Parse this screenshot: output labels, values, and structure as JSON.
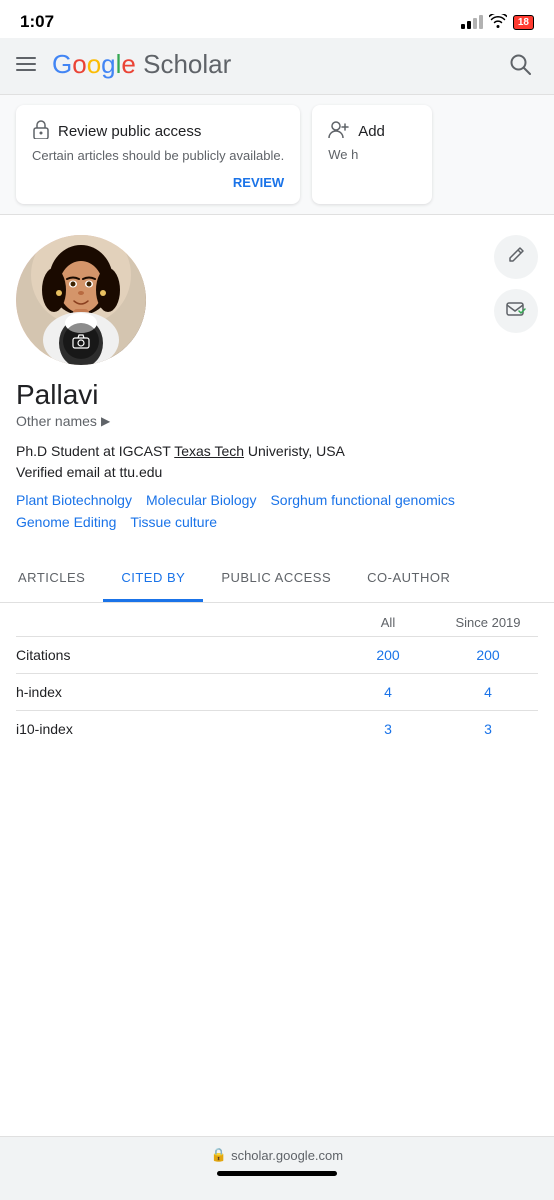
{
  "statusBar": {
    "time": "1:07",
    "battery": "18"
  },
  "header": {
    "logoLetters": [
      "G",
      "o",
      "o",
      "g",
      "l",
      "e"
    ],
    "logoScholar": " Scholar",
    "menuLabel": "menu",
    "searchLabel": "search"
  },
  "banners": [
    {
      "icon": "🔒",
      "title": "Review public access",
      "subtitle": "Certain articles should be publicly available.",
      "action": "REVIEW"
    },
    {
      "icon": "👤+",
      "title": "Add",
      "subtitle": "We h"
    }
  ],
  "profile": {
    "name": "Pallavi",
    "otherNamesLabel": "Other names",
    "otherNamesArrow": "▶",
    "affiliation": "Ph.D Student at IGCAST Texas Tech Univeristy, USA",
    "email": "Verified email at ttu.edu",
    "tags": [
      "Plant Biotechnolgy",
      "Molecular Biology",
      "Sorghum functional genomics",
      "Genome Editing",
      "Tissue culture"
    ],
    "editIcon": "✏",
    "emailIcon": "✉"
  },
  "tabs": [
    {
      "id": "articles",
      "label": "ARTICLES",
      "active": false
    },
    {
      "id": "cited-by",
      "label": "CITED BY",
      "active": true
    },
    {
      "id": "public-access",
      "label": "PUBLIC ACCESS",
      "active": false
    },
    {
      "id": "co-authors",
      "label": "CO-AUTHOR",
      "active": false
    }
  ],
  "stats": {
    "colHeaders": [
      "All",
      "Since 2019"
    ],
    "rows": [
      {
        "label": "Citations",
        "all": "200",
        "since": "200"
      },
      {
        "label": "h-index",
        "all": "4",
        "since": "4"
      },
      {
        "label": "i10-index",
        "all": "3",
        "since": "3"
      }
    ]
  },
  "urlBar": {
    "lockIcon": "🔒",
    "url": "scholar.google.com"
  }
}
